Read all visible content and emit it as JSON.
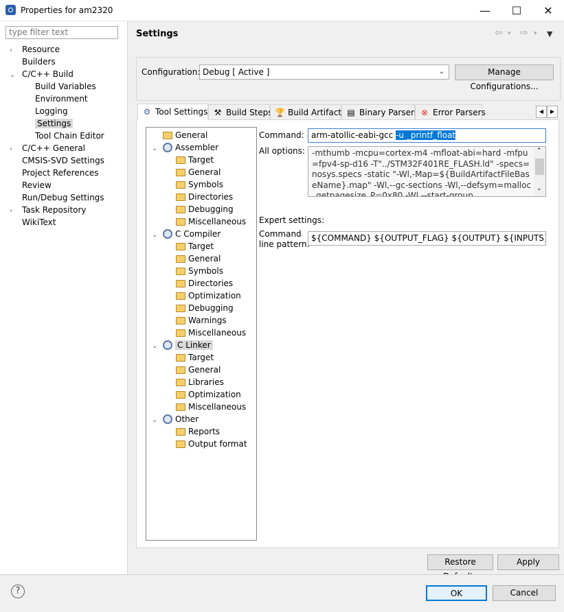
{
  "window": {
    "title": "Properties for am2320",
    "min": "—",
    "max": "☐",
    "close": "✕"
  },
  "filter": {
    "placeholder": "type filter text"
  },
  "nav": {
    "items": [
      {
        "label": "Resource",
        "indent": 0,
        "expander": "›"
      },
      {
        "label": "Builders",
        "indent": 0,
        "expander": ""
      },
      {
        "label": "C/C++ Build",
        "indent": 0,
        "expander": "⌄"
      },
      {
        "label": "Build Variables",
        "indent": 1,
        "expander": ""
      },
      {
        "label": "Environment",
        "indent": 1,
        "expander": ""
      },
      {
        "label": "Logging",
        "indent": 1,
        "expander": ""
      },
      {
        "label": "Settings",
        "indent": 1,
        "expander": "",
        "selected": true
      },
      {
        "label": "Tool Chain Editor",
        "indent": 1,
        "expander": ""
      },
      {
        "label": "C/C++ General",
        "indent": 0,
        "expander": "›"
      },
      {
        "label": "CMSIS-SVD Settings",
        "indent": 0,
        "expander": ""
      },
      {
        "label": "Project References",
        "indent": 0,
        "expander": ""
      },
      {
        "label": "Review",
        "indent": 0,
        "expander": ""
      },
      {
        "label": "Run/Debug Settings",
        "indent": 0,
        "expander": ""
      },
      {
        "label": "Task Repository",
        "indent": 0,
        "expander": "›"
      },
      {
        "label": "WikiText",
        "indent": 0,
        "expander": ""
      }
    ]
  },
  "header": {
    "title": "Settings"
  },
  "config": {
    "label": "Configuration:",
    "value": "Debug  [ Active ]",
    "manage_label": "Manage Configurations..."
  },
  "tabs": [
    {
      "label": "Tool Settings",
      "icon": "tool-settings-icon",
      "glyph": "⚙",
      "active": true
    },
    {
      "label": "Build Steps",
      "icon": "build-steps-icon",
      "glyph": "⚒"
    },
    {
      "label": "Build Artifact",
      "icon": "trophy-icon",
      "glyph": "🏆"
    },
    {
      "label": "Binary Parsers",
      "icon": "binary-file-icon",
      "glyph": "▤"
    },
    {
      "label": "Error Parsers",
      "icon": "error-icon",
      "glyph": "⊗"
    }
  ],
  "tree": [
    {
      "label": "General",
      "level": 1,
      "icon": "folder",
      "exp": ""
    },
    {
      "label": "Assembler",
      "level": 0,
      "icon": "gear",
      "exp": "⌄"
    },
    {
      "label": "Target",
      "level": 2,
      "icon": "folder",
      "exp": ""
    },
    {
      "label": "General",
      "level": 2,
      "icon": "folder",
      "exp": ""
    },
    {
      "label": "Symbols",
      "level": 2,
      "icon": "folder",
      "exp": ""
    },
    {
      "label": "Directories",
      "level": 2,
      "icon": "folder",
      "exp": ""
    },
    {
      "label": "Debugging",
      "level": 2,
      "icon": "folder",
      "exp": ""
    },
    {
      "label": "Miscellaneous",
      "level": 2,
      "icon": "folder",
      "exp": ""
    },
    {
      "label": "C Compiler",
      "level": 0,
      "icon": "gear",
      "exp": "⌄"
    },
    {
      "label": "Target",
      "level": 2,
      "icon": "folder",
      "exp": ""
    },
    {
      "label": "General",
      "level": 2,
      "icon": "folder",
      "exp": ""
    },
    {
      "label": "Symbols",
      "level": 2,
      "icon": "folder",
      "exp": ""
    },
    {
      "label": "Directories",
      "level": 2,
      "icon": "folder",
      "exp": ""
    },
    {
      "label": "Optimization",
      "level": 2,
      "icon": "folder",
      "exp": ""
    },
    {
      "label": "Debugging",
      "level": 2,
      "icon": "folder",
      "exp": ""
    },
    {
      "label": "Warnings",
      "level": 2,
      "icon": "folder",
      "exp": ""
    },
    {
      "label": "Miscellaneous",
      "level": 2,
      "icon": "folder",
      "exp": ""
    },
    {
      "label": "C Linker",
      "level": 0,
      "icon": "gear",
      "exp": "⌄",
      "selected": true
    },
    {
      "label": "Target",
      "level": 2,
      "icon": "folder",
      "exp": ""
    },
    {
      "label": "General",
      "level": 2,
      "icon": "folder",
      "exp": ""
    },
    {
      "label": "Libraries",
      "level": 2,
      "icon": "folder",
      "exp": ""
    },
    {
      "label": "Optimization",
      "level": 2,
      "icon": "folder",
      "exp": ""
    },
    {
      "label": "Miscellaneous",
      "level": 2,
      "icon": "folder",
      "exp": ""
    },
    {
      "label": "Other",
      "level": 0,
      "icon": "gear",
      "exp": "⌄"
    },
    {
      "label": "Reports",
      "level": 2,
      "icon": "folder",
      "exp": ""
    },
    {
      "label": "Output format",
      "level": 2,
      "icon": "folder",
      "exp": ""
    }
  ],
  "command": {
    "label": "Command:",
    "value_plain": "arm-atollic-eabi-gcc ",
    "value_selected": "-u _printf_float"
  },
  "all_options": {
    "label": "All options:",
    "value": "-mthumb -mcpu=cortex-m4 -mfloat-abi=hard -mfpu=fpv4-sp-d16 -T\"../STM32F401RE_FLASH.ld\" -specs=nosys.specs -static \"-Wl,-Map=${BuildArtifactFileBaseName}.map\" -Wl,--gc-sections -Wl,--defsym=malloc_getpagesize_P=0x80 -Wl,--start-group"
  },
  "expert": {
    "heading": "Expert settings:",
    "label_line1": "Command",
    "label_line2": "line pattern:",
    "value": "${COMMAND} ${OUTPUT_FLAG} ${OUTPUT} ${INPUTS} ${FLAGS}"
  },
  "buttons": {
    "restore": "Restore Defaults",
    "apply": "Apply",
    "ok": "OK",
    "cancel": "Cancel",
    "help": "?"
  }
}
